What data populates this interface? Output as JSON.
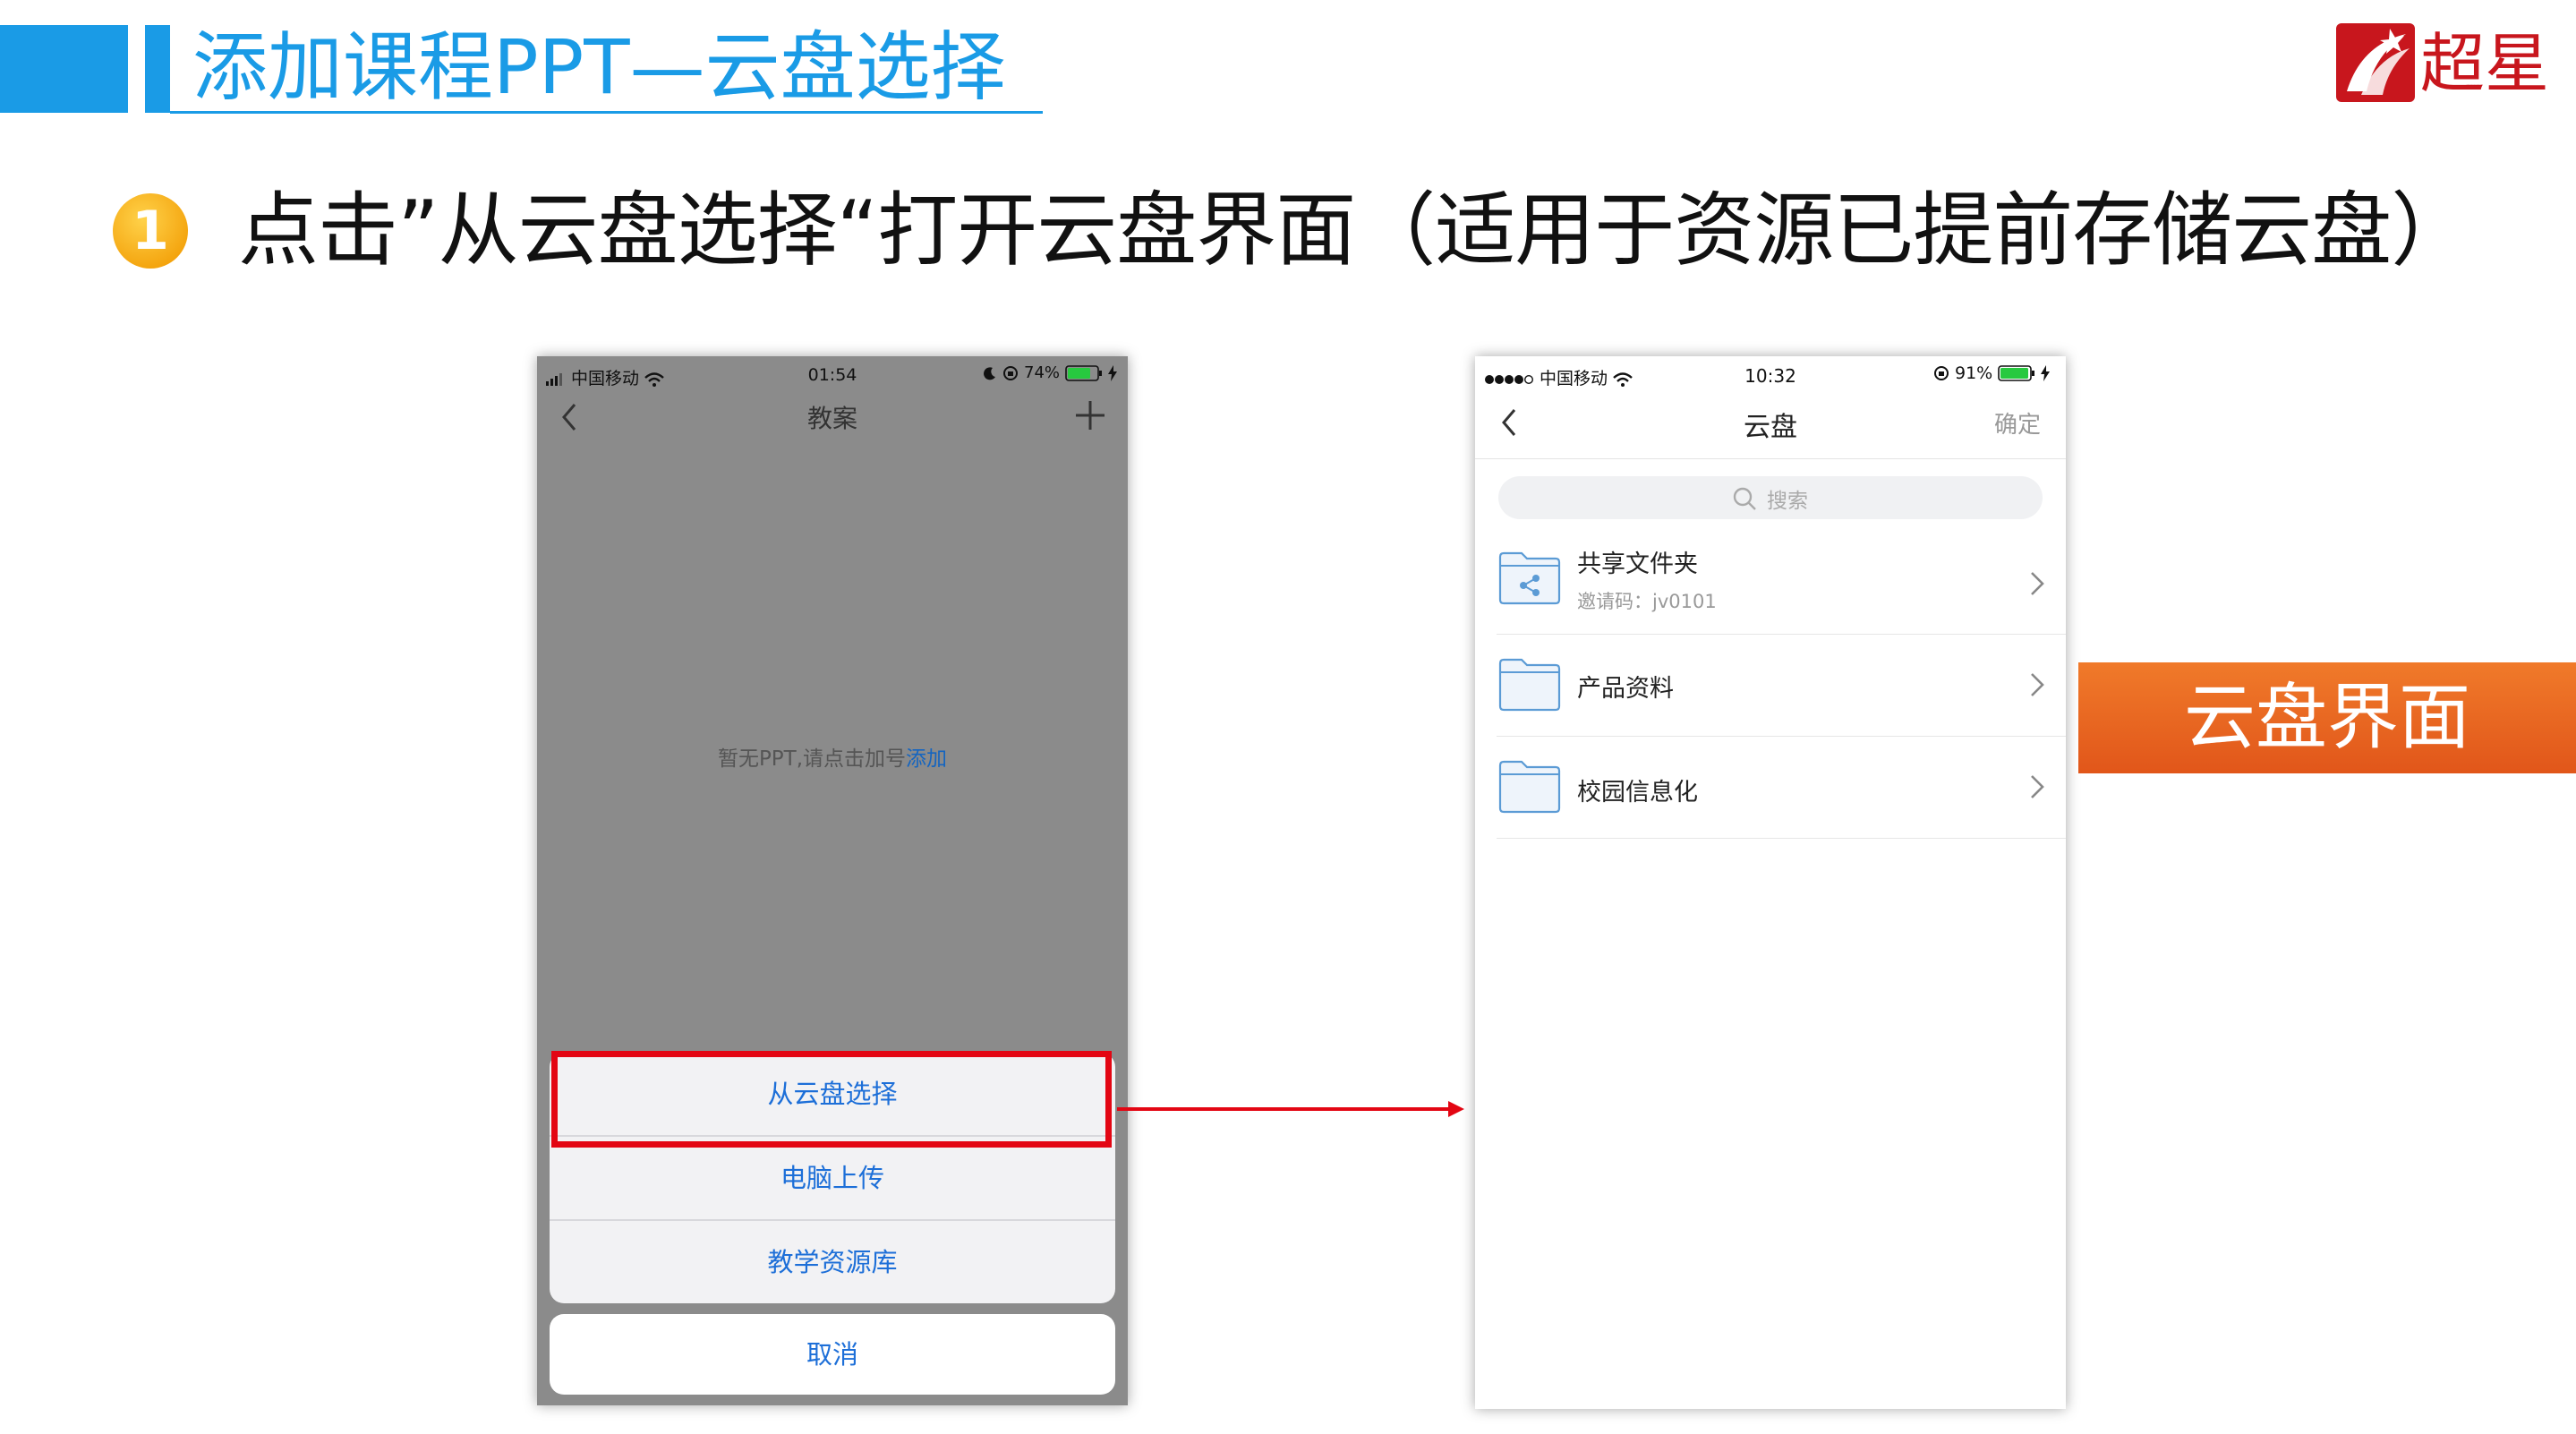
{
  "slide": {
    "title": "添加课程PPT—云盘选择",
    "step_number": "1",
    "step_text": "点击”从云盘选择“打开云盘界面（适用于资源已提前存储云盘）",
    "side_label": "云盘界面",
    "logo_text": "超星"
  },
  "phone_left": {
    "status": {
      "carrier": "中国移动",
      "time": "01:54",
      "battery": "74%"
    },
    "nav": {
      "title": "教案"
    },
    "empty_text": "暂无PPT,请点击加号",
    "empty_link": "添加",
    "action_sheet": {
      "items": [
        "从云盘选择",
        "电脑上传",
        "教学资源库"
      ],
      "cancel": "取消"
    }
  },
  "phone_right": {
    "status": {
      "carrier": "中国移动",
      "time": "10:32",
      "battery": "91%"
    },
    "nav": {
      "title": "云盘",
      "confirm": "确定"
    },
    "search_placeholder": "搜索",
    "folders": [
      {
        "name": "共享文件夹",
        "sub": "邀请码：jv0101",
        "icon": "shared-folder-icon"
      },
      {
        "name": "产品资料",
        "icon": "folder-icon"
      },
      {
        "name": "校园信息化",
        "icon": "folder-icon"
      }
    ]
  },
  "colors": {
    "accent_blue": "#1a9be6",
    "highlight_red": "#e30613",
    "label_orange": "#ea6a1e",
    "link_blue": "#1d6fd8"
  }
}
